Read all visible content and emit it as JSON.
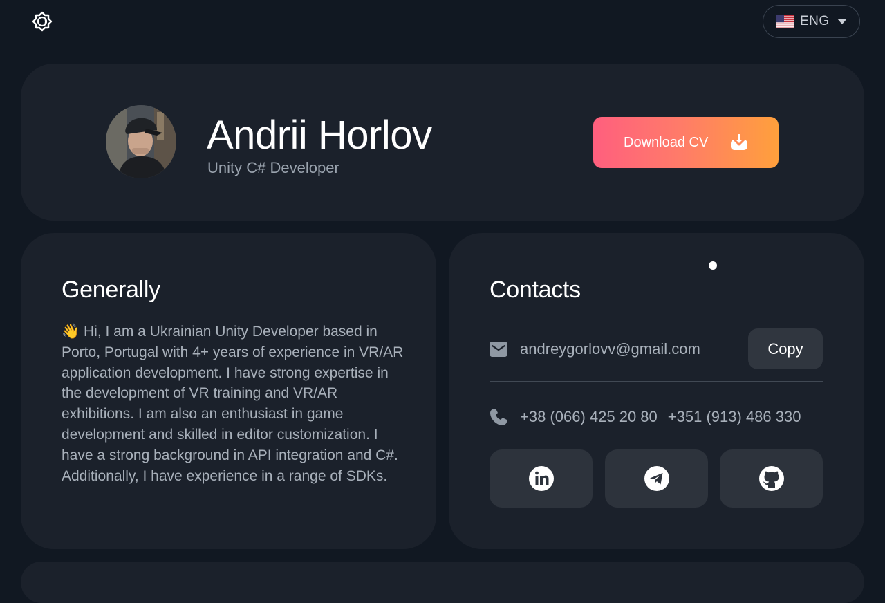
{
  "header": {
    "language": {
      "label": "ENG",
      "flag": "us-flag-icon"
    },
    "theme_toggle": {
      "icon": "brightness-icon"
    }
  },
  "profile": {
    "name": "Andrii Horlov",
    "role": "Unity C# Developer",
    "download_label": "Download CV",
    "download_icon": "download-tray-icon",
    "accent_gradient": [
      "#ff5f7e",
      "#ffa03c"
    ]
  },
  "general": {
    "title": "Generally",
    "text": "👋 Hi, I am a Ukrainian Unity Developer based in Porto, Portugal with 4+ years of experience in VR/AR application development. I have strong expertise in the development of VR training and VR/AR exhibitions. I am also an enthusiast in game development and skilled in editor customization. I have a strong background in API integration and C#. Additionally, I have experience in a range of SDKs."
  },
  "contacts": {
    "title": "Contacts",
    "email": "andreygorlovv@gmail.com",
    "copy_label": "Copy",
    "phone_ua": "+38 (066) 425 20 80",
    "phone_pt": "+351 (913) 486 330",
    "socials": [
      {
        "name": "linkedin",
        "icon": "linkedin-icon"
      },
      {
        "name": "telegram",
        "icon": "telegram-icon"
      },
      {
        "name": "github",
        "icon": "github-icon"
      }
    ]
  },
  "colors": {
    "page_bg": "#111822",
    "card_bg": "#1b212b",
    "button_bg": "#2d333c",
    "text_muted": "#a8b0ba"
  }
}
